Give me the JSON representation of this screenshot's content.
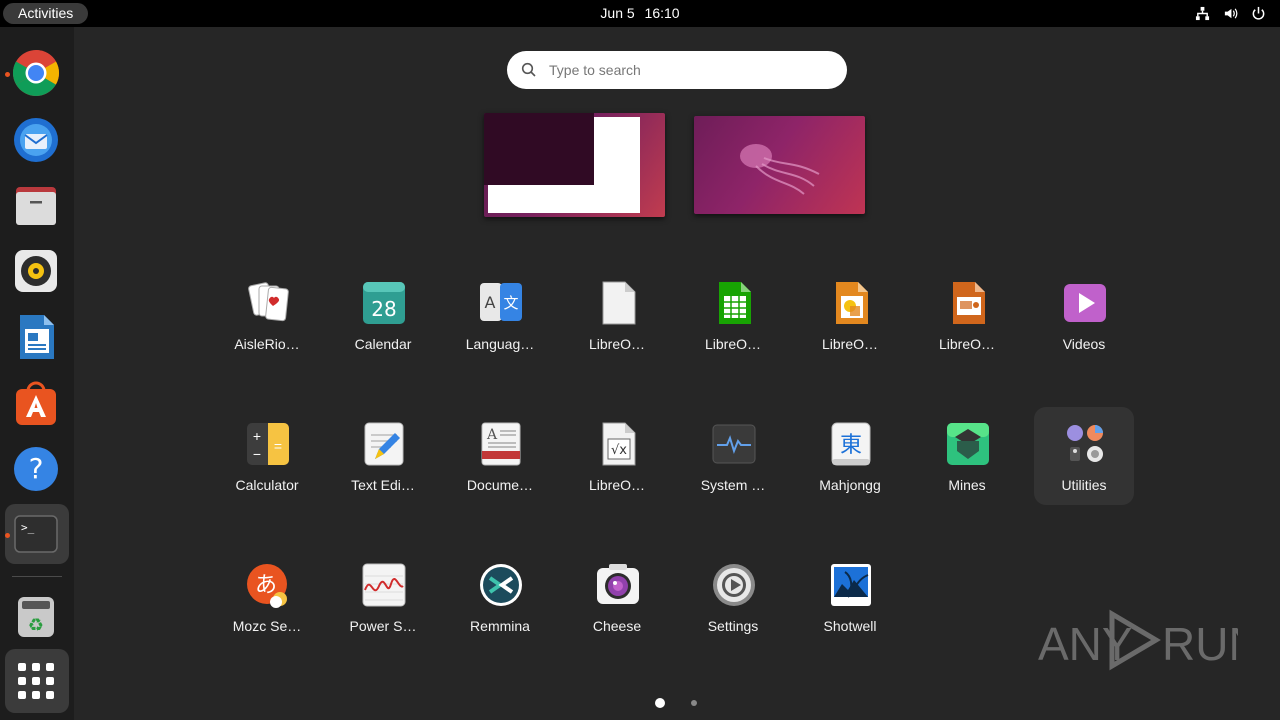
{
  "topbar": {
    "activities": "Activities",
    "date": "Jun 5",
    "time": "16:10",
    "tray_icons": [
      "network-icon",
      "volume-icon",
      "power-icon"
    ]
  },
  "dock": {
    "items": [
      {
        "name": "Google Chrome",
        "icon": "chrome-icon",
        "running": true
      },
      {
        "name": "Thunderbird",
        "icon": "thunderbird-icon",
        "running": false
      },
      {
        "name": "Files",
        "icon": "files-icon",
        "running": false
      },
      {
        "name": "Rhythmbox",
        "icon": "rhythmbox-icon",
        "running": false
      },
      {
        "name": "LibreOffice Writer",
        "icon": "writer-icon",
        "running": false
      },
      {
        "name": "Ubuntu Software",
        "icon": "software-icon",
        "running": false
      },
      {
        "name": "Help",
        "icon": "help-icon",
        "running": false
      },
      {
        "name": "Terminal",
        "icon": "terminal-icon",
        "running": true
      },
      {
        "name": "Trash",
        "icon": "trash-icon",
        "running": false
      },
      {
        "name": "Show Applications",
        "icon": "app-grid-icon",
        "running": false
      }
    ]
  },
  "search": {
    "placeholder": "Type to search"
  },
  "apps": [
    {
      "label": "AisleRio…",
      "icon": "aisleriot-icon"
    },
    {
      "label": "Calendar",
      "icon": "calendar-icon",
      "icon_text": "28"
    },
    {
      "label": "Languag…",
      "icon": "language-icon"
    },
    {
      "label": "LibreO…",
      "icon": "libreoffice-icon"
    },
    {
      "label": "LibreO…",
      "icon": "libreoffice-calc-icon"
    },
    {
      "label": "LibreO…",
      "icon": "libreoffice-draw-icon"
    },
    {
      "label": "LibreO…",
      "icon": "libreoffice-impress-icon"
    },
    {
      "label": "Videos",
      "icon": "videos-icon"
    },
    {
      "label": "Calculator",
      "icon": "calculator-icon"
    },
    {
      "label": "Text Edi…",
      "icon": "text-editor-icon"
    },
    {
      "label": "Docume…",
      "icon": "document-viewer-icon"
    },
    {
      "label": "LibreO…",
      "icon": "libreoffice-math-icon"
    },
    {
      "label": "System …",
      "icon": "system-monitor-icon"
    },
    {
      "label": "Mahjongg",
      "icon": "mahjongg-icon",
      "icon_text": "東"
    },
    {
      "label": "Mines",
      "icon": "mines-icon"
    },
    {
      "label": "Utilities",
      "icon": "utilities-folder-icon"
    },
    {
      "label": "Mozc Se…",
      "icon": "mozc-icon",
      "icon_text": "あ"
    },
    {
      "label": "Power S…",
      "icon": "power-statistics-icon"
    },
    {
      "label": "Remmina",
      "icon": "remmina-icon"
    },
    {
      "label": "Cheese",
      "icon": "cheese-icon"
    },
    {
      "label": "Settings",
      "icon": "settings-icon"
    },
    {
      "label": "Shotwell",
      "icon": "shotwell-icon"
    }
  ],
  "pages": {
    "count": 2,
    "current": 1
  },
  "watermark": {
    "text": "ANY RUN"
  },
  "colors": {
    "accent": "#e95420",
    "panel": "#000000",
    "background": "#262626",
    "dock": "#1d1d1d"
  }
}
